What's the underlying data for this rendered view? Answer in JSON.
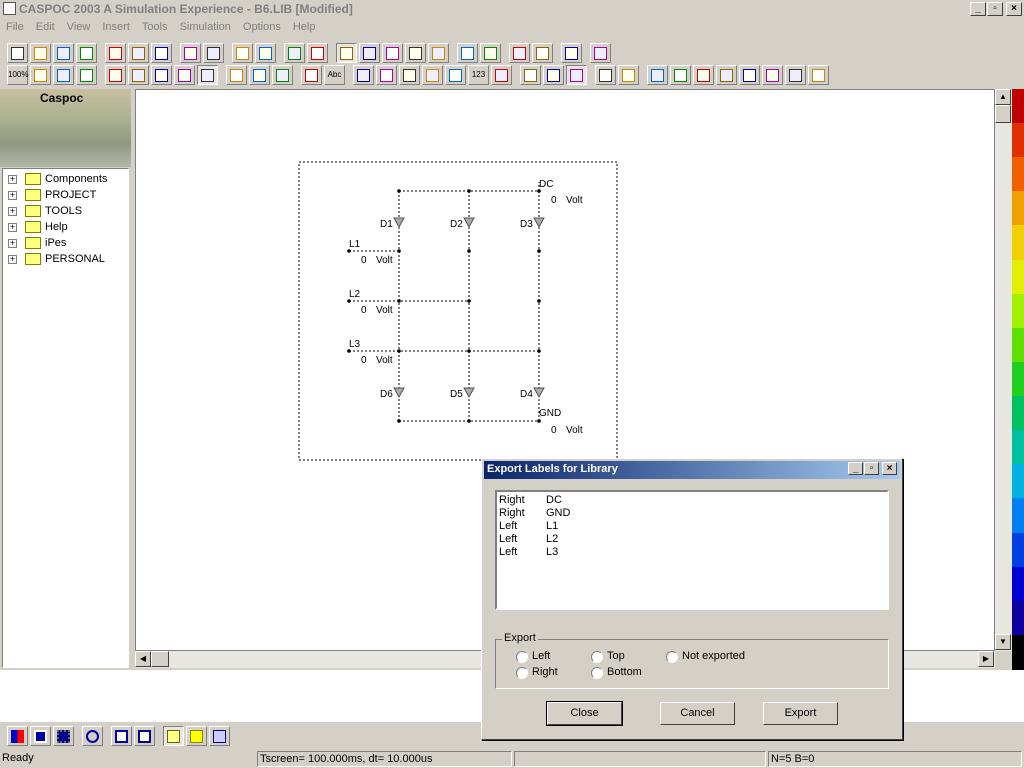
{
  "window": {
    "title": "CASPOC 2003 A Simulation Experience - B6.LIB [Modified]"
  },
  "menu": [
    "File",
    "Edit",
    "View",
    "Insert",
    "Tools",
    "Simulation",
    "Options",
    "Help"
  ],
  "toolbar1": [
    "new-icon",
    "open-icon",
    "save-icon",
    "print-icon",
    "cut-icon",
    "copy-icon",
    "paste-icon",
    "undo-icon",
    "redo-icon",
    "play-icon",
    "pause-icon",
    "wire-icon",
    "line-icon",
    "hand-icon",
    "scope-icon",
    "list-icon",
    "list2-icon",
    "list3-icon",
    "arrow-right-icon",
    "arrow-c-icon",
    "export-icon",
    "import-icon",
    "swap-icon",
    "help-icon"
  ],
  "toolbar2": [
    "zoom-100-icon",
    "zoom-fit-icon",
    "zoom-h-icon",
    "zoom-v-icon",
    "cap-icon",
    "res-icon",
    "ind-icon",
    "trans-icon",
    "diode-icon",
    "globe-icon",
    "globe2-icon",
    "globe3-icon",
    "probe-icon",
    "text-icon",
    "color-icon",
    "node-icon",
    "arrow-icon",
    "arrow2-icon",
    "switch-icon",
    "number-icon",
    "edit-icon",
    "cross-icon",
    "grid-icon",
    "clock-icon",
    "fill-icon",
    "bar-icon",
    "move-icon",
    "rotate-icon",
    "mirror-icon",
    "sort-icon",
    "chip-icon",
    "chip2-icon",
    "chip3-icon",
    "table-icon"
  ],
  "toolbar2_zoom_label": "100%",
  "toolbar2_text_label": "Abc",
  "toolbar2_number_label": "123",
  "logo": "Caspoc",
  "tree": [
    "Components",
    "PROJECT",
    "TOOLS",
    "Help",
    "iPes",
    "PERSONAL"
  ],
  "schematic": {
    "labels": {
      "DC": "DC",
      "GND": "GND",
      "L1": "L1",
      "L2": "L2",
      "L3": "L3",
      "D1": "D1",
      "D2": "D2",
      "D3": "D3",
      "D4": "D4",
      "D5": "D5",
      "D6": "D6",
      "volt_value": "0",
      "volt_unit": "Volt"
    }
  },
  "statusbar": {
    "ready": "Ready",
    "tscreen": "Tscreen= 100.000ms, dt= 10.000us",
    "counts": "N=5 B=0"
  },
  "dialog": {
    "title": "Export Labels for Library",
    "rows": [
      {
        "side": "Right",
        "name": "DC"
      },
      {
        "side": "Right",
        "name": "GND"
      },
      {
        "side": "Left",
        "name": "L1"
      },
      {
        "side": "Left",
        "name": "L2"
      },
      {
        "side": "Left",
        "name": "L3"
      }
    ],
    "group_label": "Export",
    "options": {
      "left": "Left",
      "right": "Right",
      "top": "Top",
      "bottom": "Bottom",
      "not_exported": "Not exported"
    },
    "buttons": {
      "close": "Close",
      "cancel": "Cancel",
      "export": "Export"
    }
  },
  "colors": {
    "titlebar_inactive_text": "#808080",
    "dialog_title_start": "#0a246a",
    "dialog_title_end": "#a6caf0"
  },
  "colorbar": [
    "#c00000",
    "#e03000",
    "#f06000",
    "#f0a000",
    "#f0d000",
    "#e0f000",
    "#a0f000",
    "#60e000",
    "#20d020",
    "#00c060",
    "#00c0a0",
    "#00b0e0",
    "#0080f0",
    "#0040e0",
    "#0000d0",
    "#1000a0",
    "#000000"
  ]
}
